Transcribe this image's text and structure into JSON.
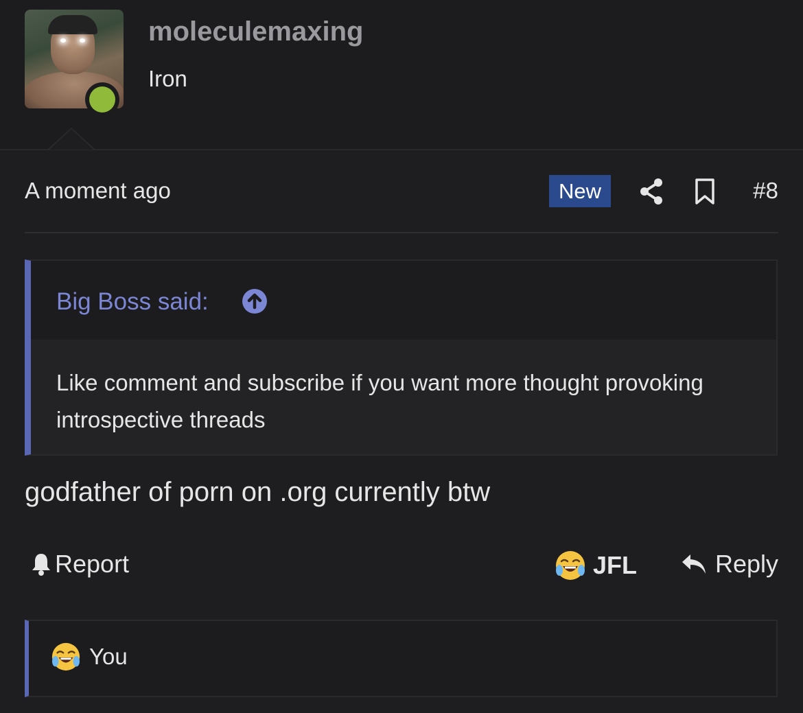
{
  "user": {
    "username": "moleculemaxing",
    "title": "Iron",
    "status": "online",
    "status_color": "#8fba3a"
  },
  "post": {
    "timestamp": "A moment ago",
    "badge": "New",
    "number": "#8",
    "icons": [
      "share-icon",
      "bookmark-icon"
    ],
    "quote": {
      "author_label": "Big Boss said:",
      "text": "Like comment and subscribe if you want more thought provoking introspective threads"
    },
    "message": "godfather of porn on .org currently btw",
    "actions": {
      "report_label": "Report",
      "reaction_label": "JFL",
      "reply_label": "Reply"
    },
    "reactions_summary": {
      "emoji": "tears-of-joy-emoji",
      "users_label": "You"
    }
  },
  "colors": {
    "background": "#1c1c1e",
    "accent": "#5a67b5",
    "quote_author": "#7b86d4",
    "new_badge": "#2b4a8e"
  }
}
